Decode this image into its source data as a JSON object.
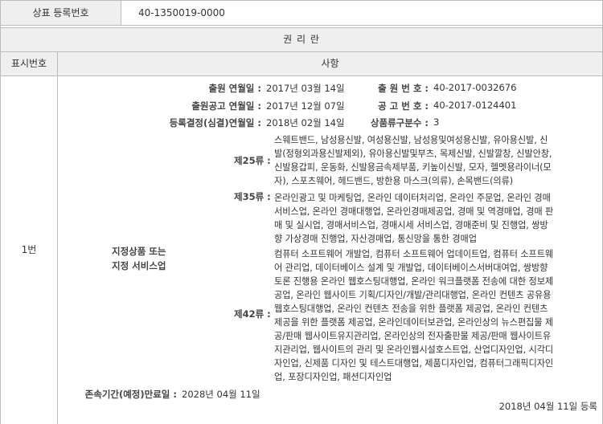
{
  "top": {
    "label": "상표 등록번호",
    "value": "40-1350019-0000"
  },
  "section_title": "권 리 란",
  "header": {
    "number": "표시번호",
    "matter": "사항"
  },
  "entry_number": "1번",
  "fields": {
    "app_date_label": "출원 연월일 :",
    "app_date": "2017년 03월 14일",
    "app_no_label": "출 원 번 호 :",
    "app_no": "40-2017-0032676",
    "pub_date_label": "출원공고 연월일 :",
    "pub_date": "2017년 12월 07일",
    "pub_no_label": "공 고 번 호 :",
    "pub_no": "40-2017-0124401",
    "decision_label": "등록결정(심결)연월일 :",
    "decision_date": "2018년 02월 14일",
    "class_count_label": "상품류구분수 :",
    "class_count": "3"
  },
  "designated_label_1": "지정상품 또는",
  "designated_label_2": "지정 서비스업",
  "classes": [
    {
      "label": "제25류 :",
      "lines": [
        "스웨트밴드, 남성용신발, 여성용신발, 남성용및여성용신발, 유아용신발, 신",
        "발(정형외과용신발제외), 유아용신발및부츠, 목제신발, 신발깔창, 신발안창,",
        "신발용갑피, 운동화, 신발용금속제부품, 키높이신발, 모자, 헬멧용라이너(모",
        "자), 스포츠웨어, 헤드밴드, 방한용 마스크(의류), 손목밴드(의류)"
      ]
    },
    {
      "label": "제35류 :",
      "lines": [
        "온라인광고 및 마케팅업, 온라인 데이터처리업, 온라인 주문업, 온라인 경매",
        "서비스업, 온라인 경매대행업, 온라인경매제공업, 경매 및 역경매업, 경매 판",
        "매 및 실시업, 경매서비스업, 경매시세 서비스업, 경매준비 및 진행업, 쌍방",
        "향 가상경매 진행업, 자산경매업, 통신망을 통한 경매업"
      ]
    },
    {
      "label": "제42류 :",
      "lines": [
        "컴퓨터 소프트웨어 개발업, 컴퓨터 소프트웨어 업데이트업, 컴퓨터 소프트웨",
        "어 관리업, 데이터베이스 설계 및 개발업, 데이터베이스서버대여업, 쌍방향",
        "토론 진행용 온라인 웹호스팅대행업, 온라인 워크플랫폼 전송에 대한 정보제",
        "공업, 온라인 웹사이트 기획/디자인/개발/관리대행업, 온라인 컨텐츠 공유용",
        "웹호스팅대행업, 온라인 컨텐츠 전송을 위한 플랫폼 제공업, 온라인 컨텐츠",
        "제공을 위한 플랫폼 제공업, 온라인데이터보관업, 온라인상의 뉴스편집물 제",
        "공/판매 웹사이트유지관리업, 온라인상의 전자출판물 제공/판매 웹사이트유",
        "지관리업, 웹사이트의 관리 및 온라인웹시설호스트업, 산업디자인업, 시각디",
        "자인업, 신제품 디자인 및 테스트대행업, 제품디자인업, 컴퓨터그래픽디자인",
        "업, 포장디자인업, 패션디자인업"
      ]
    }
  ],
  "expiry_label": "존속기간(예정)만료일 :",
  "expiry_date": "2028년 04월 11일",
  "registered_note": "2018년 04월 11일 등록"
}
